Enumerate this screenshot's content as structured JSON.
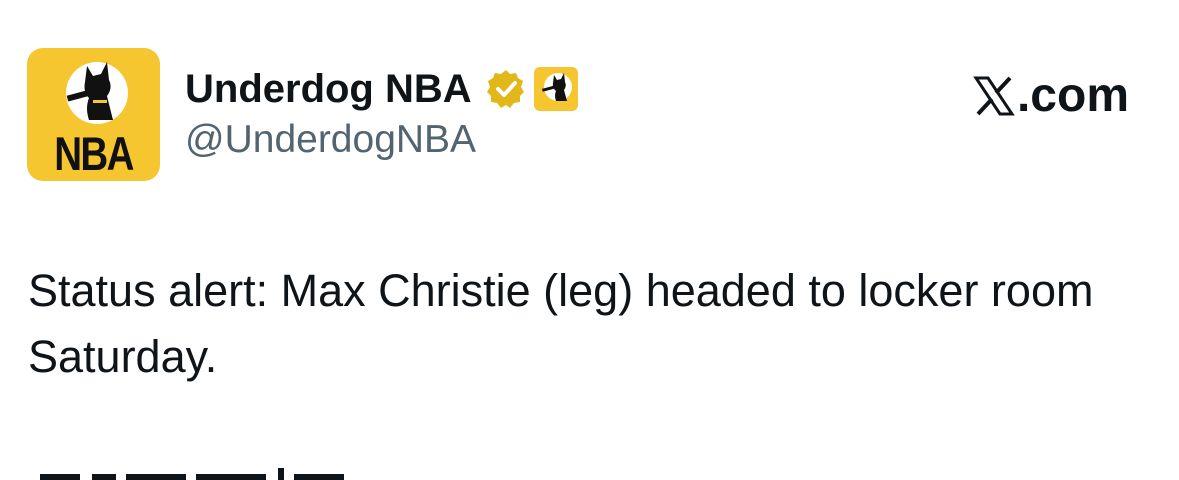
{
  "author": {
    "display_name": "Underdog NBA",
    "handle": "@UnderdogNBA",
    "avatar_text": "NBA",
    "avatar_bg_color": "#f6c630",
    "verified_badge_color": "#e2b719",
    "badge_icon": "verified-gold-icon",
    "affiliate_icon": "underdog-affiliate-icon"
  },
  "source": {
    "logo_icon": "x-logo-icon",
    "label": ".com"
  },
  "tweet": {
    "text": "Status alert: Max Christie (leg) headed to locker room Saturday."
  },
  "colors": {
    "text_primary": "#0f1419",
    "text_secondary": "#536471",
    "background": "#ffffff"
  }
}
